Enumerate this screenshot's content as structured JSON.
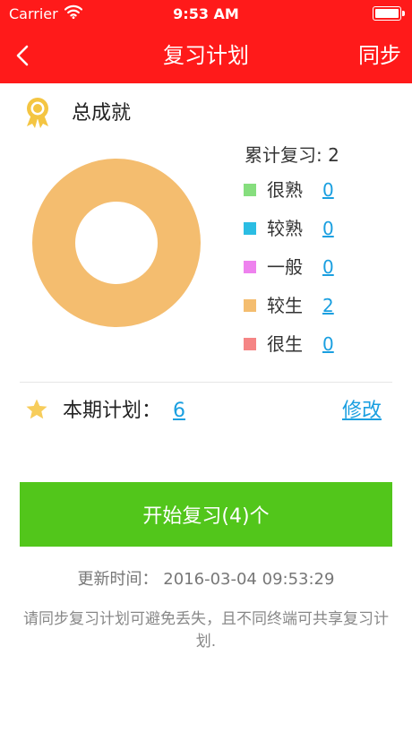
{
  "status_bar": {
    "carrier": "Carrier",
    "time": "9:53 AM"
  },
  "nav": {
    "title": "复习计划",
    "sync": "同步"
  },
  "achievement": {
    "title": "总成就",
    "total_label": "累计复习:",
    "total_value": "2",
    "legend": [
      {
        "label": "很熟",
        "value": "0",
        "color": "#86de7e"
      },
      {
        "label": "较熟",
        "value": "0",
        "color": "#2bbde3"
      },
      {
        "label": "一般",
        "value": "0",
        "color": "#ee82ee"
      },
      {
        "label": "较生",
        "value": "2",
        "color": "#f4bd6f"
      },
      {
        "label": "很生",
        "value": "0",
        "color": "#f58585"
      }
    ]
  },
  "chart_data": {
    "type": "pie",
    "categories": [
      "很熟",
      "较熟",
      "一般",
      "较生",
      "很生"
    ],
    "values": [
      0,
      0,
      0,
      2,
      0
    ],
    "colors": [
      "#86de7e",
      "#2bbde3",
      "#ee82ee",
      "#f4bd6f",
      "#f58585"
    ],
    "donut": true
  },
  "plan": {
    "label": "本期计划：",
    "value": "6",
    "edit": "修改"
  },
  "start_button": "开始复习(4)个",
  "update": {
    "label": "更新时间：",
    "value": "2016-03-04 09:53:29"
  },
  "tip": "请同步复习计划可避免丢失，且不同终端可共享复习计划."
}
